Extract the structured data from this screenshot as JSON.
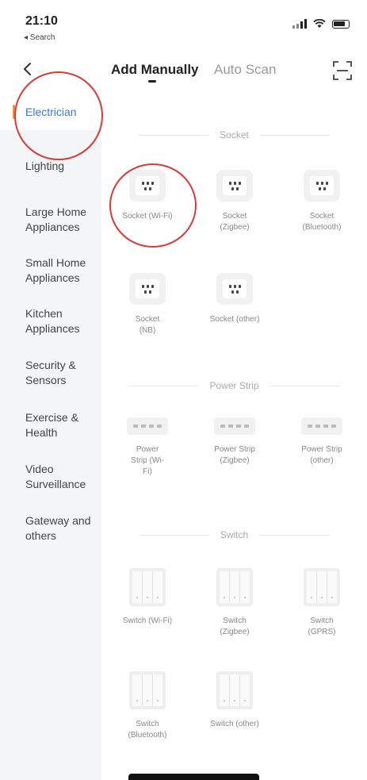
{
  "status_bar": {
    "time": "21:10",
    "back_app": "◂ Search"
  },
  "header": {
    "tabs": [
      {
        "label": "Add Manually",
        "active": true
      },
      {
        "label": "Auto Scan",
        "active": false
      }
    ]
  },
  "sidebar": {
    "items": [
      {
        "label": "Electrician",
        "active": true
      },
      {
        "label": "Lighting"
      },
      {
        "label": "Large Home Appliances"
      },
      {
        "label": "Small Home Appliances"
      },
      {
        "label": "Kitchen Appliances"
      },
      {
        "label": "Security & Sensors"
      },
      {
        "label": "Exercise & Health"
      },
      {
        "label": "Video Surveillance"
      },
      {
        "label": "Gateway and others"
      }
    ]
  },
  "sections": {
    "socket": {
      "title": "Socket",
      "items": [
        {
          "label": "Socket (Wi-Fi)"
        },
        {
          "label": "Socket (Zigbee)"
        },
        {
          "label": "Socket (Bluetooth)"
        },
        {
          "label": "Socket (NB)"
        },
        {
          "label": "Socket (other)"
        }
      ]
    },
    "power_strip": {
      "title": "Power Strip",
      "items": [
        {
          "label": "Power Strip (Wi-Fi)"
        },
        {
          "label": "Power Strip (Zigbee)"
        },
        {
          "label": "Power Strip (other)"
        }
      ]
    },
    "switch": {
      "title": "Switch",
      "items": [
        {
          "label": "Switch (Wi-Fi)"
        },
        {
          "label": "Switch (Zigbee)"
        },
        {
          "label": "Switch (GPRS)"
        },
        {
          "label": "Switch (Bluetooth)"
        },
        {
          "label": "Switch (other)"
        }
      ]
    }
  },
  "colors": {
    "accent": "#3a7bd5",
    "active_bar": "#f0923a",
    "annotation": "#d93a3a"
  }
}
